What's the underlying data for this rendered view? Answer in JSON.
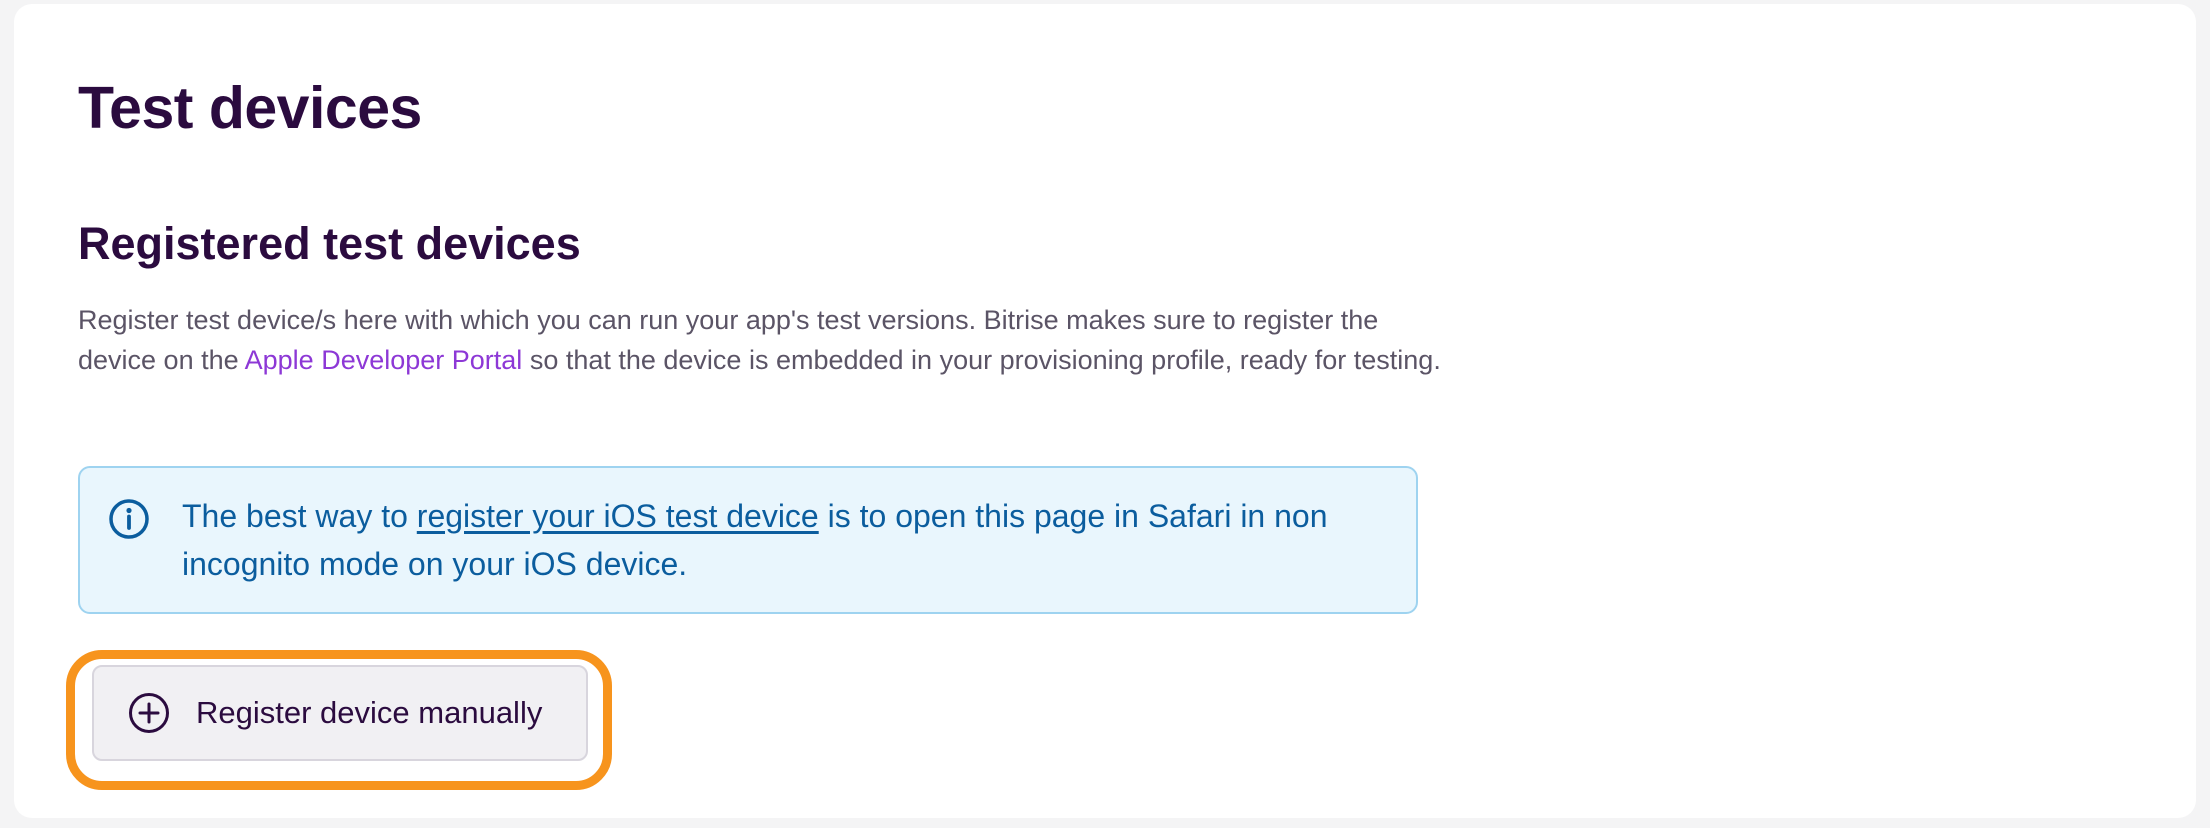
{
  "page": {
    "title": "Test devices"
  },
  "section": {
    "title": "Registered test devices",
    "description_before": "Register test device/s here with which you can run your app's test versions. Bitrise makes sure to register the device on the ",
    "description_link": "Apple Developer Portal",
    "description_after": " so that the device is embedded in your provisioning profile, ready for testing."
  },
  "info_notice": {
    "icon": "info-icon",
    "text_before": "The best way to ",
    "link_text": "register your iOS test device",
    "text_after": " is to open this page in Safari in non incognito mode on your iOS device."
  },
  "register_button": {
    "icon": "plus-circle-icon",
    "label": "Register device manually"
  },
  "colors": {
    "heading": "#2b0b3f",
    "link_purple": "#8d38d6",
    "info_text": "#0b5d9e",
    "info_background": "#e9f6fd",
    "highlight_outline": "#f7941d"
  }
}
